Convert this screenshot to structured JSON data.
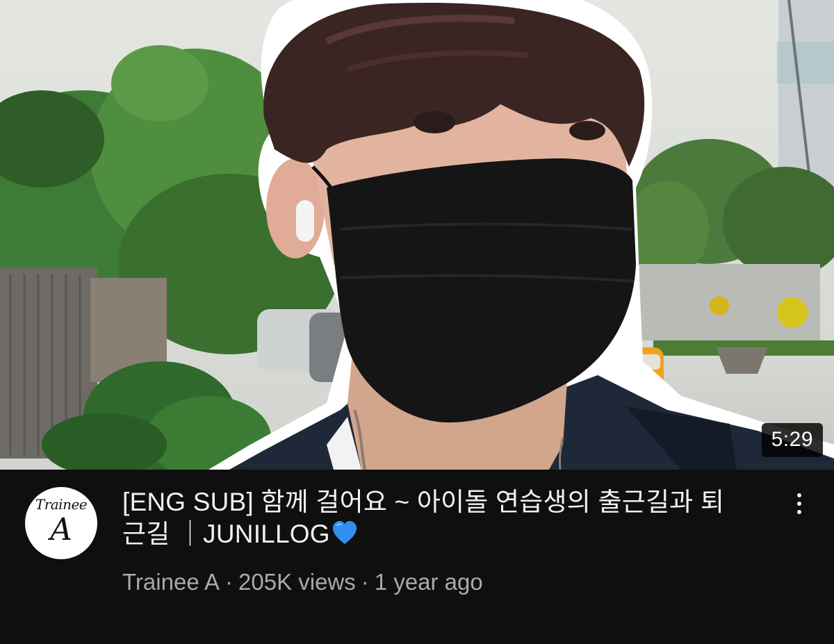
{
  "video": {
    "duration": "5:29",
    "title": "[ENG SUB] 함께 걸어요 ~ 아이돌 연습생의 출근길과 퇴근길 ｜JUNILLOG",
    "title_emoji_icon": "blue-heart-icon",
    "channel": "Trainee A",
    "separator": "·",
    "views": "205K views",
    "age": "1 year ago"
  },
  "avatar": {
    "line1": "Trainee",
    "line2": "A"
  },
  "colors": {
    "background": "#0f0f0f",
    "title_text": "#f1f1f1",
    "meta_text": "#aaaaaa",
    "heart": "#2f8ff0",
    "duration_badge": "#000000"
  }
}
